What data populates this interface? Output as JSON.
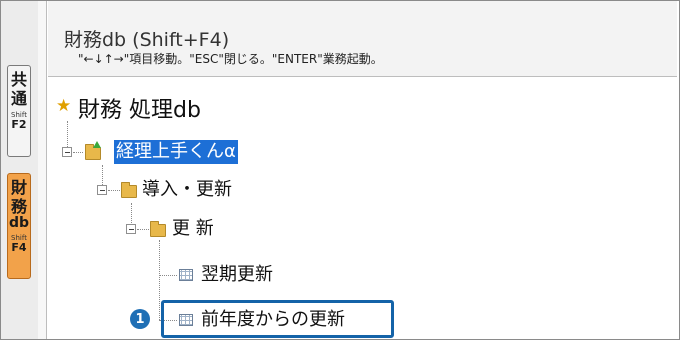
{
  "sidebar": {
    "common_tab": {
      "label": "共通",
      "line1": "共",
      "line2": "通",
      "shortcut_small": "Shift",
      "shortcut_key": "F2"
    },
    "finance_tab": {
      "label": "財務db",
      "line1": "財",
      "line2": "務",
      "line3": "db",
      "shortcut_small": "Shift",
      "shortcut_key": "F4"
    }
  },
  "header": {
    "title": "財務db (Shift+F4)",
    "help": "\"←↓↑→\"項目移動。\"ESC\"閉じる。\"ENTER\"業務起動。"
  },
  "tree": {
    "root": {
      "label": "財務 処理db",
      "icon": "star-icon"
    },
    "nodes": [
      {
        "label": "経理上手くんα",
        "icon": "folder-green-arrow-icon",
        "selected": true
      },
      {
        "label": "導入・更新",
        "icon": "folder-icon"
      },
      {
        "label": "更 新",
        "icon": "folder-icon"
      },
      {
        "label": "翌期更新",
        "icon": "grid-icon"
      },
      {
        "label": "前年度からの更新",
        "icon": "grid-icon",
        "highlighted": true
      }
    ]
  },
  "callout": {
    "badge": "1"
  },
  "colors": {
    "accent_orange": "#f2a24a",
    "selection_blue": "#1d6fd6",
    "highlight_box": "#1463a8"
  }
}
